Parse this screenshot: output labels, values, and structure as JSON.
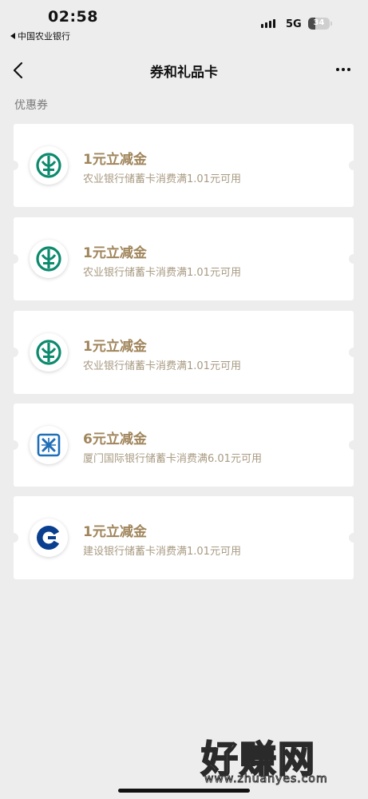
{
  "status_bar": {
    "time": "02:58",
    "back_app": "中国农业银行",
    "network": "5G",
    "battery": "34",
    "battery_level": 0.34
  },
  "nav": {
    "title": "券和礼品卡",
    "back_icon": "chevron-left-icon",
    "more_icon": "more-horizontal-icon"
  },
  "section": {
    "label": "优惠券"
  },
  "coupons": [
    {
      "bank": "abc",
      "logo_icon": "agricultural-bank-logo-icon",
      "title": "1元立减金",
      "desc": "农业银行储蓄卡消费满1.01元可用"
    },
    {
      "bank": "abc",
      "logo_icon": "agricultural-bank-logo-icon",
      "title": "1元立减金",
      "desc": "农业银行储蓄卡消费满1.01元可用"
    },
    {
      "bank": "abc",
      "logo_icon": "agricultural-bank-logo-icon",
      "title": "1元立减金",
      "desc": "农业银行储蓄卡消费满1.01元可用"
    },
    {
      "bank": "xib",
      "logo_icon": "xiamen-international-bank-logo-icon",
      "title": "6元立减金",
      "desc": "厦门国际银行储蓄卡消费满6.01元可用"
    },
    {
      "bank": "ccb",
      "logo_icon": "construction-bank-logo-icon",
      "title": "1元立减金",
      "desc": "建设银行储蓄卡消费满1.01元可用"
    }
  ],
  "watermark": {
    "title": "好赚网",
    "url": "www.zhuanyes.com"
  },
  "colors": {
    "page_background": "#ededed",
    "coupon_title": "#a0855b",
    "coupon_desc": "#a89a82",
    "abc_green": "#0c8a6e",
    "ccb_blue": "#0a3f8f",
    "xib_blue": "#1e6fb8"
  }
}
